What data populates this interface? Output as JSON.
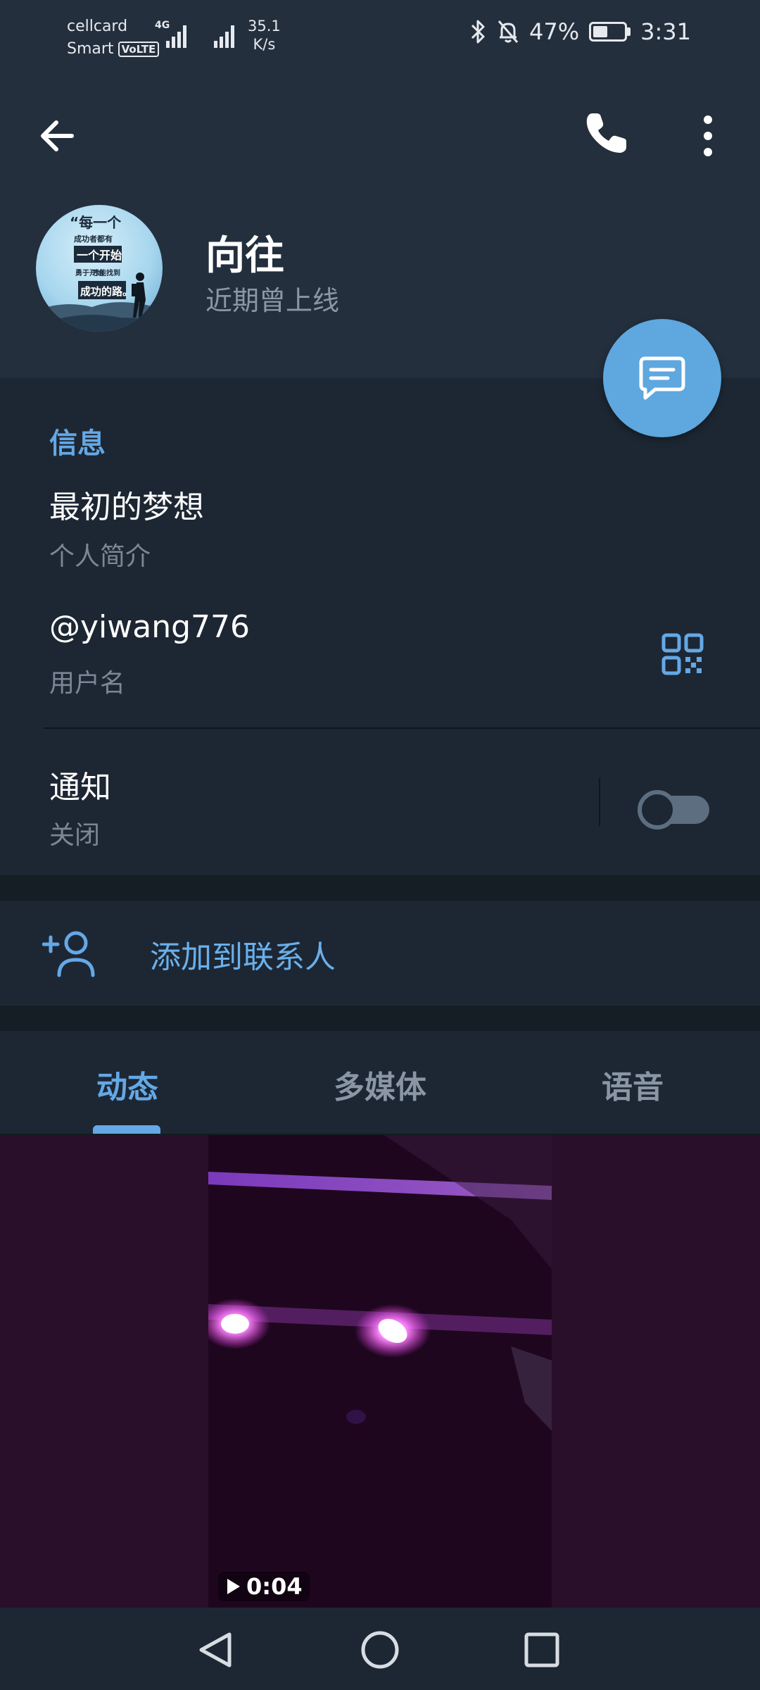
{
  "status_bar": {
    "carrier_line1": "cellcard",
    "carrier_line2": "Smart",
    "volte": "VoLTE",
    "network": "4G",
    "speed_value": "35.1",
    "speed_unit": "K/s",
    "battery_percent": "47%",
    "battery_level": 0.47,
    "time": "3:31",
    "icons": [
      "signal-icon",
      "bluetooth-icon",
      "mute-bell-icon",
      "battery-icon"
    ]
  },
  "header": {
    "back_icon": "arrow-left-icon",
    "call_icon": "phone-icon",
    "more_icon": "more-vertical-icon",
    "name": "向往",
    "status": "近期曾上线",
    "avatar_text": [
      "“每一个",
      "成功者都有",
      "一个开始",
      "勇于开始",
      "才能找到",
      "成功的路。"
    ]
  },
  "fab": {
    "icon": "chat-message-icon"
  },
  "info": {
    "title": "信息",
    "bio": "最初的梦想",
    "bio_label": "个人简介",
    "username": "@yiwang776",
    "username_label": "用户名",
    "qr_icon": "qr-code-icon",
    "notifications": "通知",
    "notifications_state": "关闭",
    "notifications_on": false
  },
  "add_contact": {
    "icon": "add-person-icon",
    "label": "添加到联系人"
  },
  "tabs": [
    {
      "label": "动态",
      "active": true
    },
    {
      "label": "多媒体",
      "active": false
    },
    {
      "label": "语音",
      "active": false
    }
  ],
  "media": {
    "duration": "0:04",
    "play_icon": "play-icon"
  },
  "nav_bar": {
    "icons": [
      "back-triangle-icon",
      "home-circle-icon",
      "recents-square-icon"
    ]
  },
  "colors": {
    "accent": "#64a8e6",
    "fab": "#5ea7df",
    "background": "#1d2733",
    "header": "#232f3d"
  }
}
